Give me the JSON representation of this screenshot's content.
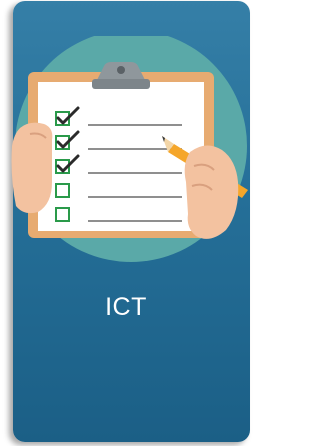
{
  "card": {
    "title": "ICT",
    "icon": "clipboard-checklist-icon",
    "checklist": [
      {
        "checked": true
      },
      {
        "checked": true
      },
      {
        "checked": true
      },
      {
        "checked": false
      },
      {
        "checked": false
      }
    ]
  },
  "colors": {
    "card_top": "#357fa7",
    "card_bottom": "#1b5f86",
    "circle": "#5aa9a8",
    "board": "#e7ab71",
    "paper": "#ffffff",
    "check": "#2a9a4a",
    "clip": "#8f979c",
    "skin": "#f3c2a0",
    "pencil": "#f5a62a",
    "title_text": "#ffffff"
  }
}
